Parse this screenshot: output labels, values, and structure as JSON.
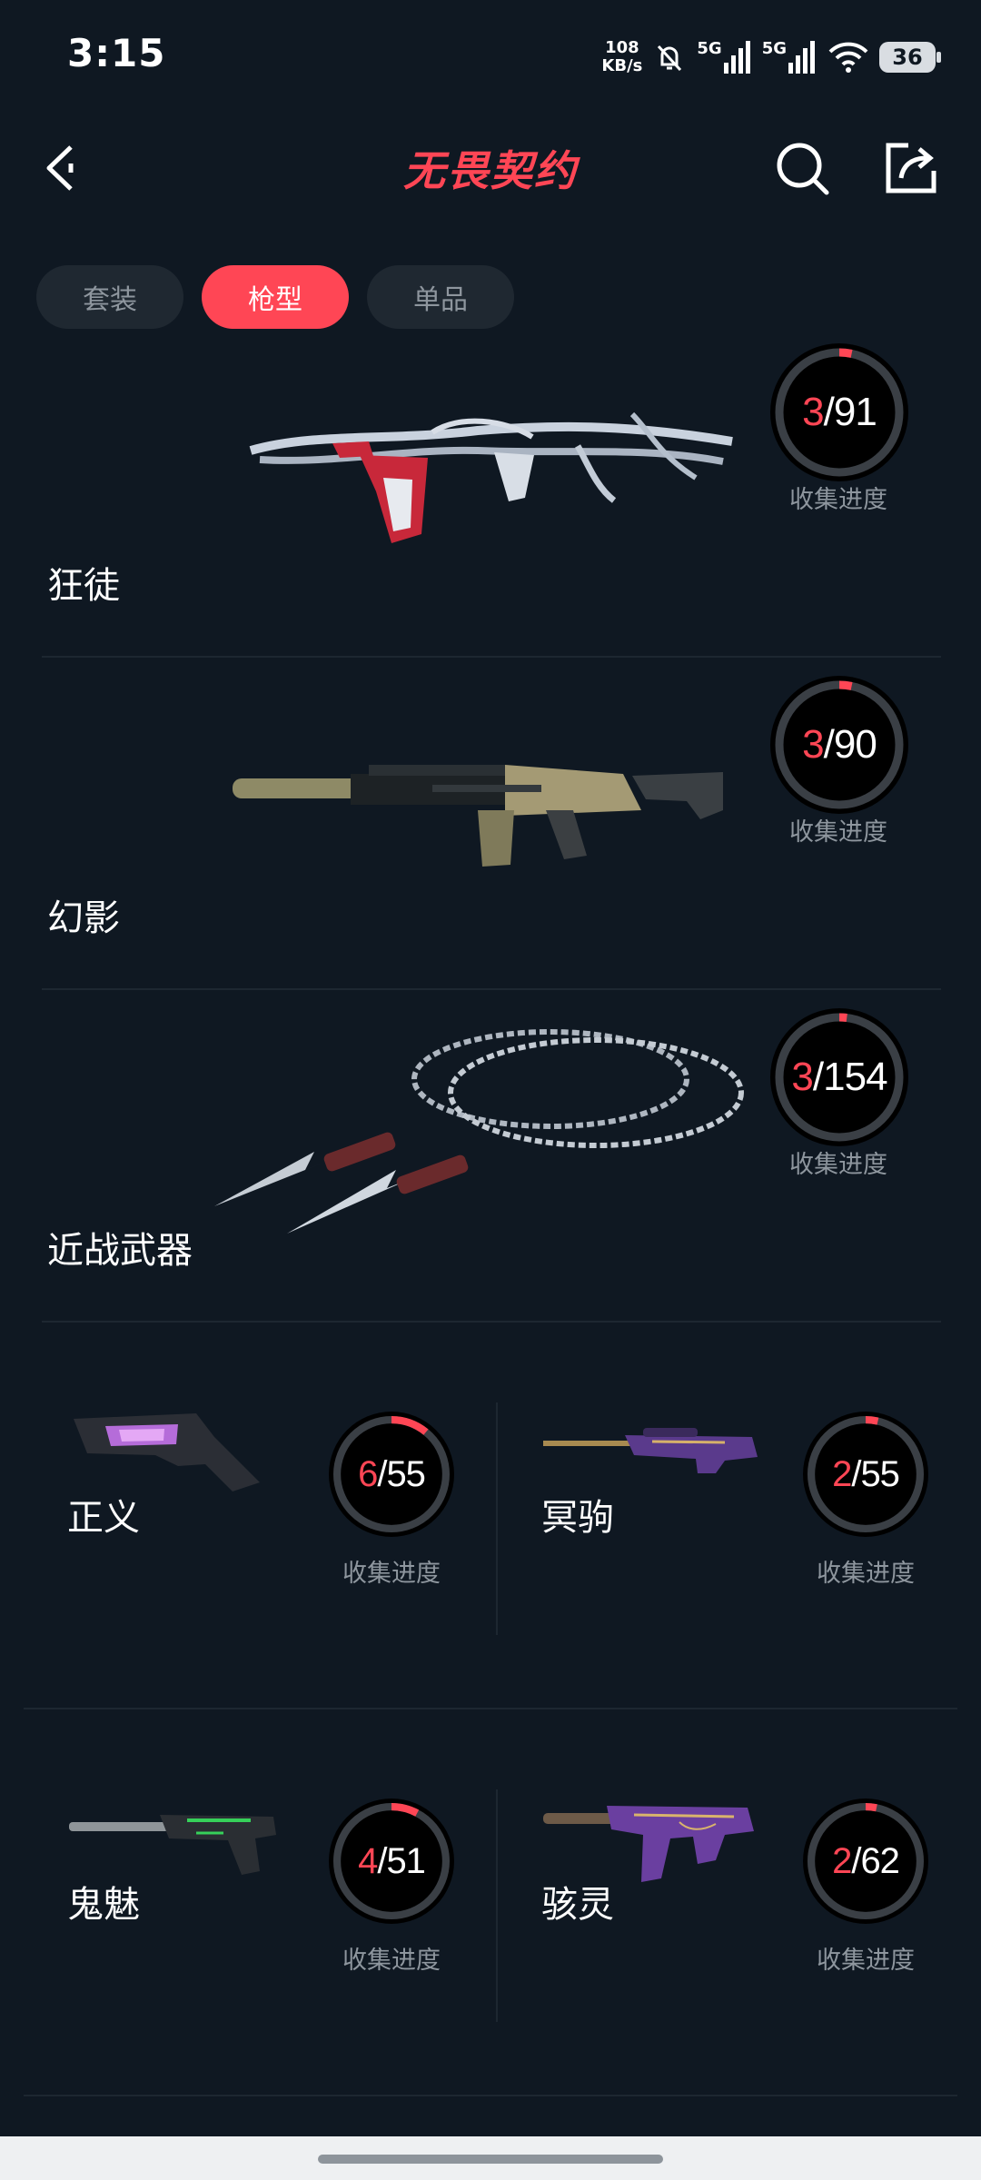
{
  "status_bar": {
    "time": "3:15",
    "net_speed_value": "108",
    "net_speed_unit": "KB/s",
    "sig1": "5G",
    "sig2": "5G",
    "battery": "36"
  },
  "header": {
    "title": "无畏契约",
    "accent_color": "#ff4655"
  },
  "tabs": [
    {
      "label": "套装",
      "active": false
    },
    {
      "label": "枪型",
      "active": true
    },
    {
      "label": "单品",
      "active": false
    }
  ],
  "big_items": [
    {
      "name": "狂徒",
      "collected": "3",
      "total": "91",
      "progress_label": "收集进度",
      "progress": 0.033
    },
    {
      "name": "幻影",
      "collected": "3",
      "total": "90",
      "progress_label": "收集进度",
      "progress": 0.033
    },
    {
      "name": "近战武器",
      "collected": "3",
      "total": "154",
      "progress_label": "收集进度",
      "progress": 0.019
    }
  ],
  "grid_items": [
    {
      "name": "正义",
      "collected": "6",
      "total": "55",
      "progress_label": "收集进度",
      "progress": 0.109
    },
    {
      "name": "冥驹",
      "collected": "2",
      "total": "55",
      "progress_label": "收集进度",
      "progress": 0.036
    },
    {
      "name": "鬼魅",
      "collected": "4",
      "total": "51",
      "progress_label": "收集进度",
      "progress": 0.078
    },
    {
      "name": "骇灵",
      "collected": "2",
      "total": "62",
      "progress_label": "收集进度",
      "progress": 0.032
    }
  ]
}
